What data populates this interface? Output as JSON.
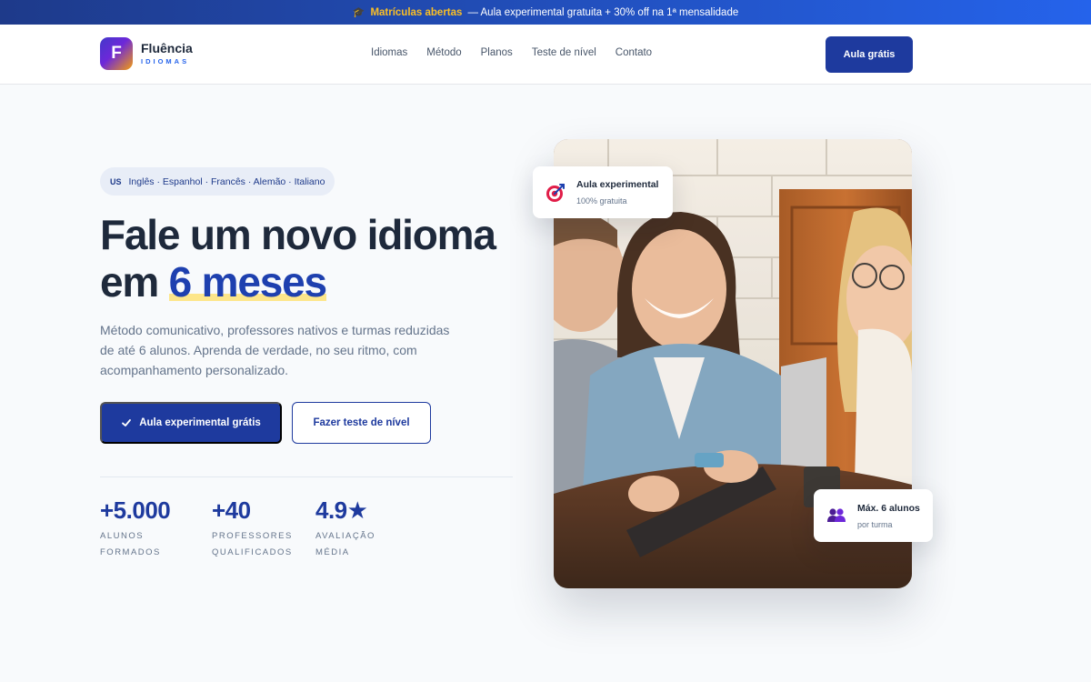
{
  "announcement": {
    "icon": "graduation-cap-icon",
    "highlight": "Matrículas abertas",
    "text": "— Aula experimental gratuita + 30% off na 1ª mensalidade"
  },
  "header": {
    "logo_letter": "F",
    "brand_name": "Fluência",
    "brand_sub": "IDIOMAS",
    "nav": [
      "Idiomas",
      "Método",
      "Planos",
      "Teste de nível",
      "Contato"
    ],
    "cta": "Aula grátis"
  },
  "hero": {
    "languages_flag": "US",
    "languages": "Inglês · Espanhol · Francês · Alemão · Italiano",
    "headline_line1": "Fale um novo idioma",
    "headline_line2_prefix": "em ",
    "headline_accent": "6 meses",
    "lead": "Método comunicativo, professores nativos e turmas reduzidas de até 6 alunos. Aprenda de verdade, no seu ritmo, com acompanhamento personalizado.",
    "primary_button": "Aula experimental grátis",
    "secondary_button": "Fazer teste de nível",
    "stats": [
      {
        "value": "+5.000",
        "label_line1": "ALUNOS",
        "label_line2": "FORMADOS"
      },
      {
        "value": "+40",
        "label_line1": "PROFESSORES",
        "label_line2": "QUALIFICADOS"
      },
      {
        "value": "4.9★",
        "label_line1": "AVALIAÇÃO",
        "label_line2": "MÉDIA"
      }
    ]
  },
  "cards": {
    "trial": {
      "icon": "target-icon",
      "title": "Aula experimental",
      "subtitle": "100% gratuita"
    },
    "class_size": {
      "icon": "people-icon",
      "title": "Máx. 6 alunos",
      "subtitle": "por turma"
    }
  },
  "colors": {
    "primary": "#1e3a9e",
    "accent_highlight": "#fbbf24",
    "text_dark": "#1e293b",
    "text_muted": "#64748b"
  }
}
